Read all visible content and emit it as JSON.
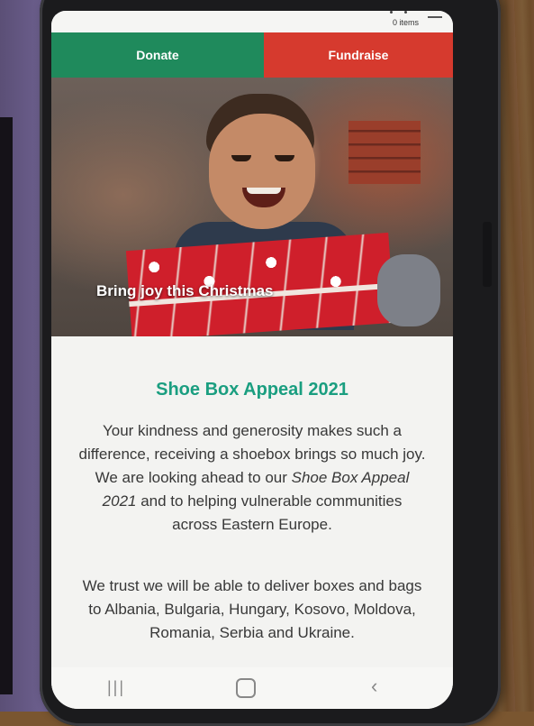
{
  "header": {
    "cart_count_label": "0 items"
  },
  "actions": {
    "donate_label": "Donate",
    "fundraise_label": "Fundraise",
    "donate_color": "#1f8a5c",
    "fundraise_color": "#d63a2e"
  },
  "hero": {
    "caption": "Bring joy this Christmas"
  },
  "content": {
    "title": "Shoe Box Appeal 2021",
    "title_color": "#1a9e80",
    "paragraph1_a": "Your kindness and generosity makes such a difference, receiving a shoebox brings so much joy. We are looking ahead to our ",
    "paragraph1_em": "Shoe Box Appeal 2021",
    "paragraph1_b": " and to helping vulnerable communities across Eastern Europe.",
    "paragraph2": "We trust we will be able to deliver boxes and bags to Albania, Bulgaria, Hungary, Kosovo, Moldova, Romania, Serbia and Ukraine."
  },
  "navbar": {
    "recent_icon": "recent-apps-icon",
    "home_icon": "home-icon",
    "back_icon": "back-icon",
    "recent_glyph": "|||",
    "back_glyph": "‹"
  }
}
